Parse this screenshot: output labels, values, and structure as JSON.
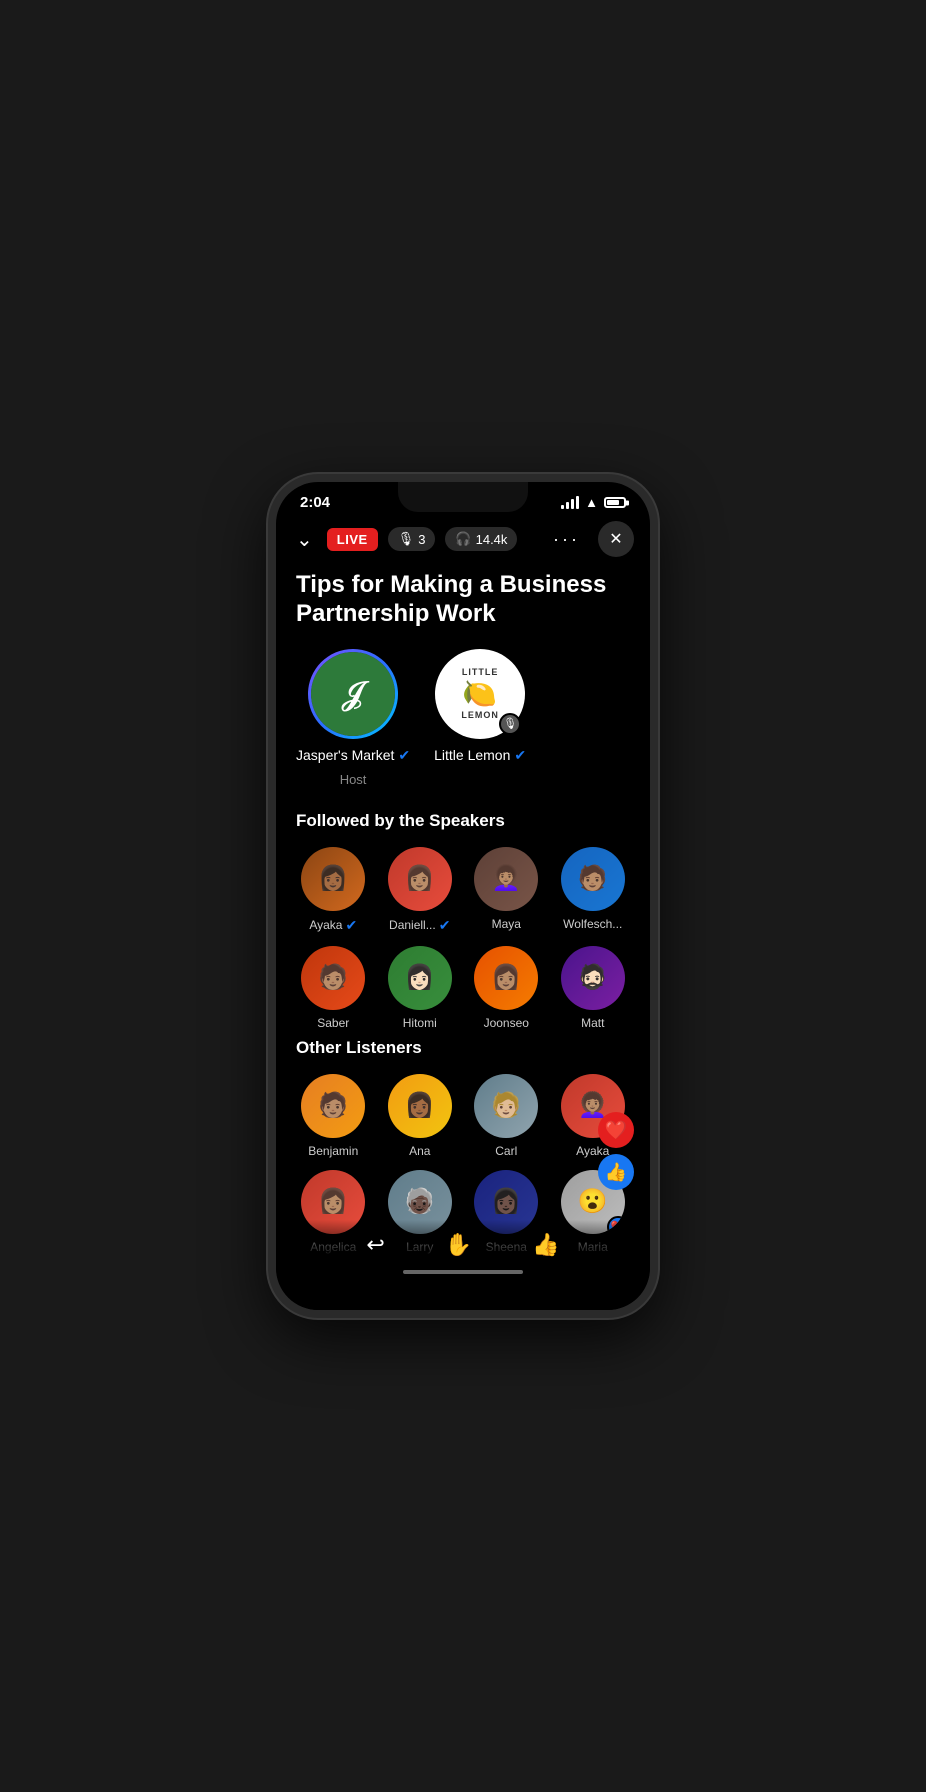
{
  "statusBar": {
    "time": "2:04",
    "signal": 4,
    "wifi": true,
    "battery": 75
  },
  "toolbar": {
    "chevron": "chevron-down",
    "liveBadge": "LIVE",
    "micCount": "3",
    "headphoneCount": "14.4k",
    "more": "...",
    "close": "×"
  },
  "room": {
    "title": "Tips for Making a Business Partnership Work"
  },
  "speakers": [
    {
      "name": "Jasper's Market",
      "verified": true,
      "role": "Host",
      "type": "jasper"
    },
    {
      "name": "Little Lemon",
      "verified": true,
      "role": "",
      "muted": true,
      "type": "lemon"
    }
  ],
  "followedSection": {
    "title": "Followed by the Speakers",
    "people": [
      {
        "name": "Ayaka",
        "verified": true,
        "color": "av-ayaka"
      },
      {
        "name": "Daniell...",
        "verified": true,
        "color": "av-danielle"
      },
      {
        "name": "Maya",
        "verified": false,
        "color": "av-maya"
      },
      {
        "name": "Wolfesch...",
        "verified": false,
        "color": "av-wolfesch"
      },
      {
        "name": "Saber",
        "verified": false,
        "color": "av-saber"
      },
      {
        "name": "Hitomi",
        "verified": false,
        "color": "av-hitomi"
      },
      {
        "name": "Joonseo",
        "verified": false,
        "color": "av-joonseo"
      },
      {
        "name": "Matt",
        "verified": false,
        "color": "av-matt"
      }
    ]
  },
  "listenersSection": {
    "title": "Other Listeners",
    "people": [
      {
        "name": "Benjamin",
        "verified": false,
        "color": "av-benjamin",
        "reaction": null
      },
      {
        "name": "Ana",
        "verified": false,
        "color": "av-ana",
        "reaction": null
      },
      {
        "name": "Carl",
        "verified": false,
        "color": "av-carl",
        "reaction": null
      },
      {
        "name": "Ayaka",
        "verified": false,
        "color": "av-ayaka2",
        "reaction": "heart"
      },
      {
        "name": "Angelica",
        "verified": false,
        "color": "av-angelica",
        "reaction": null
      },
      {
        "name": "Larry",
        "verified": false,
        "color": "av-larry",
        "reaction": null
      },
      {
        "name": "Sheena",
        "verified": false,
        "color": "av-sheena",
        "reaction": null
      },
      {
        "name": "Maria",
        "verified": false,
        "color": "av-maria",
        "reaction": "wow"
      }
    ]
  },
  "bottomActions": [
    {
      "icon": "↩",
      "name": "share"
    },
    {
      "icon": "✋",
      "name": "raise-hand"
    },
    {
      "icon": "👍",
      "name": "like"
    }
  ],
  "floatingReactions": [
    "❤️",
    "👍"
  ]
}
